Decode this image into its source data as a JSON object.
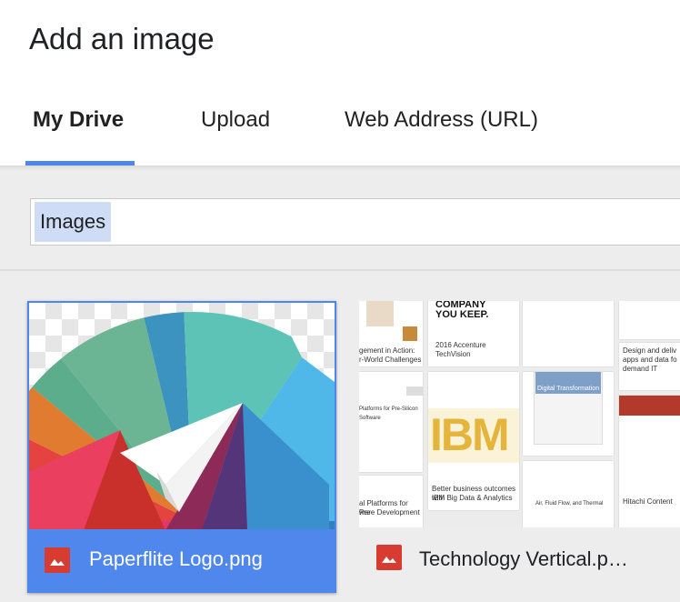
{
  "dialog": {
    "title": "Add an image"
  },
  "tabs": [
    {
      "label": "My Drive",
      "active": true
    },
    {
      "label": "Upload",
      "active": false
    },
    {
      "label": "Web Address (URL)",
      "active": false
    }
  ],
  "breadcrumb": {
    "current": "Images"
  },
  "files": [
    {
      "name": "Paperflite Logo.png",
      "selected": true,
      "icon": "image-file-icon"
    },
    {
      "name": "Technology Vertical.p…",
      "selected": false,
      "icon": "image-file-icon"
    }
  ],
  "thumbnail_text": {
    "company_line1": "COMPANY",
    "company_line2": "YOU KEEP.",
    "gement": "gement in Action:",
    "world": "r-World Challenges",
    "techvision": "2016 Accenture TechVision",
    "ibm": "IBM",
    "ibm_caption1": "Better business outcomes with",
    "ibm_caption2": "IBM Big Data & Analytics",
    "platforms1": "al Platforms for Pre-",
    "platforms2": "ware Development",
    "design1": "Design and deliv",
    "design2": "apps and data fo",
    "design3": "demand IT",
    "hitachi": "Hitachi Content",
    "digital": "Digital Transformation",
    "air": "Air, Fluid Flow, and Thermal"
  },
  "colors": {
    "accent": "#4f86ec",
    "file_icon": "#d83b2f"
  }
}
